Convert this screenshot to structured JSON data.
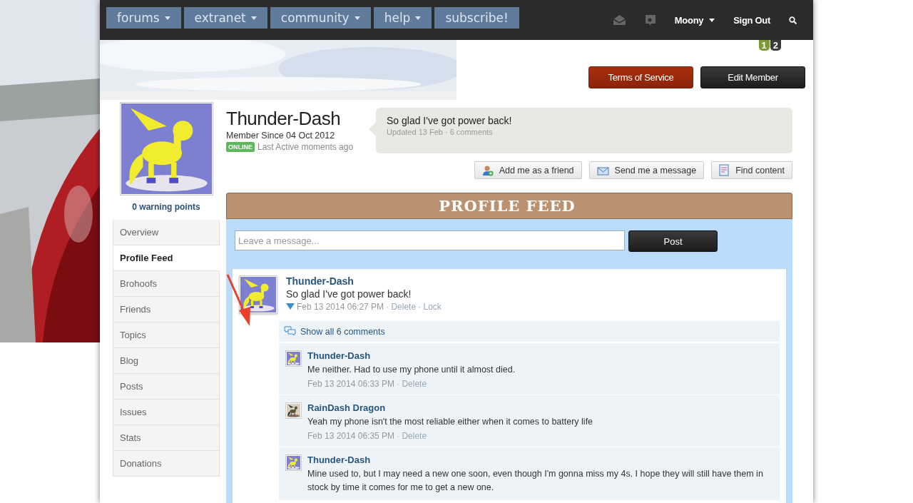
{
  "nav": {
    "tabs": [
      {
        "label": "forums",
        "kind": "menu"
      },
      {
        "label": "extranet",
        "kind": "menu"
      },
      {
        "label": "community",
        "kind": "menu"
      },
      {
        "label": "help",
        "kind": "menu"
      },
      {
        "label": "subscribe!",
        "kind": "link"
      }
    ],
    "user": "Moony",
    "sign_out": "Sign Out"
  },
  "badges": [
    {
      "label": "1",
      "color": "#7a9a3a"
    },
    {
      "label": "2",
      "color": "#3a3a3a"
    }
  ],
  "top_buttons": [
    {
      "label": "Terms of Service",
      "kind": "danger"
    },
    {
      "label": "Edit Member",
      "kind": "dark"
    }
  ],
  "profile": {
    "name": "Thunder-Dash",
    "member_since": "Member Since 04 Oct 2012",
    "status": "ONLINE",
    "last_active": "Last Active moments ago",
    "warning": "0 warning points"
  },
  "status_bubble": {
    "text": "So glad I've got power back!",
    "meta": "Updated 13 Feb · 6 comments"
  },
  "actions": [
    {
      "label": "Add me as a friend",
      "kind": "friend"
    },
    {
      "label": "Send me a message",
      "kind": "message"
    },
    {
      "label": "Find content",
      "kind": "content"
    }
  ],
  "sidebar": {
    "items": [
      {
        "label": "Overview",
        "selected": false
      },
      {
        "label": "Profile Feed",
        "selected": true
      },
      {
        "label": "Brohoofs",
        "selected": false
      },
      {
        "label": "Friends",
        "selected": false
      },
      {
        "label": "Topics",
        "selected": false
      },
      {
        "label": "Blog",
        "selected": false
      },
      {
        "label": "Posts",
        "selected": false
      },
      {
        "label": "Issues",
        "selected": false
      },
      {
        "label": "Stats",
        "selected": false
      },
      {
        "label": "Donations",
        "selected": false
      }
    ]
  },
  "feed": {
    "title": "PROFILE FEED",
    "input": {
      "placeholder": "Leave a message..."
    },
    "post_button": "Post",
    "post": {
      "author": "Thunder-Dash",
      "text": "So glad I've got power back!",
      "date": "Feb 13 2014 06:27 PM",
      "actions": [
        "· Delete",
        "· Lock"
      ],
      "show_comments": "Show all 6 comments",
      "comments": [
        {
          "author": "Thunder-Dash",
          "text": "Me neither. Had to use my phone until it almost died.",
          "date": "Feb 13 2014 06:33 PM",
          "actions": [
            "· Delete"
          ]
        },
        {
          "author": "RainDash Dragon",
          "text": "Yeah my phone isn't the most reliable either when it comes to battery life",
          "date": "Feb 13 2014 06:35 PM",
          "actions": [
            "· Delete"
          ]
        },
        {
          "author": "Thunder-Dash",
          "text": "Mine used to, but I may need a new one soon, even though I'm gonna miss my 4s. I hope they will still have them in stock by time it comes for me to get a new one."
        }
      ]
    }
  }
}
